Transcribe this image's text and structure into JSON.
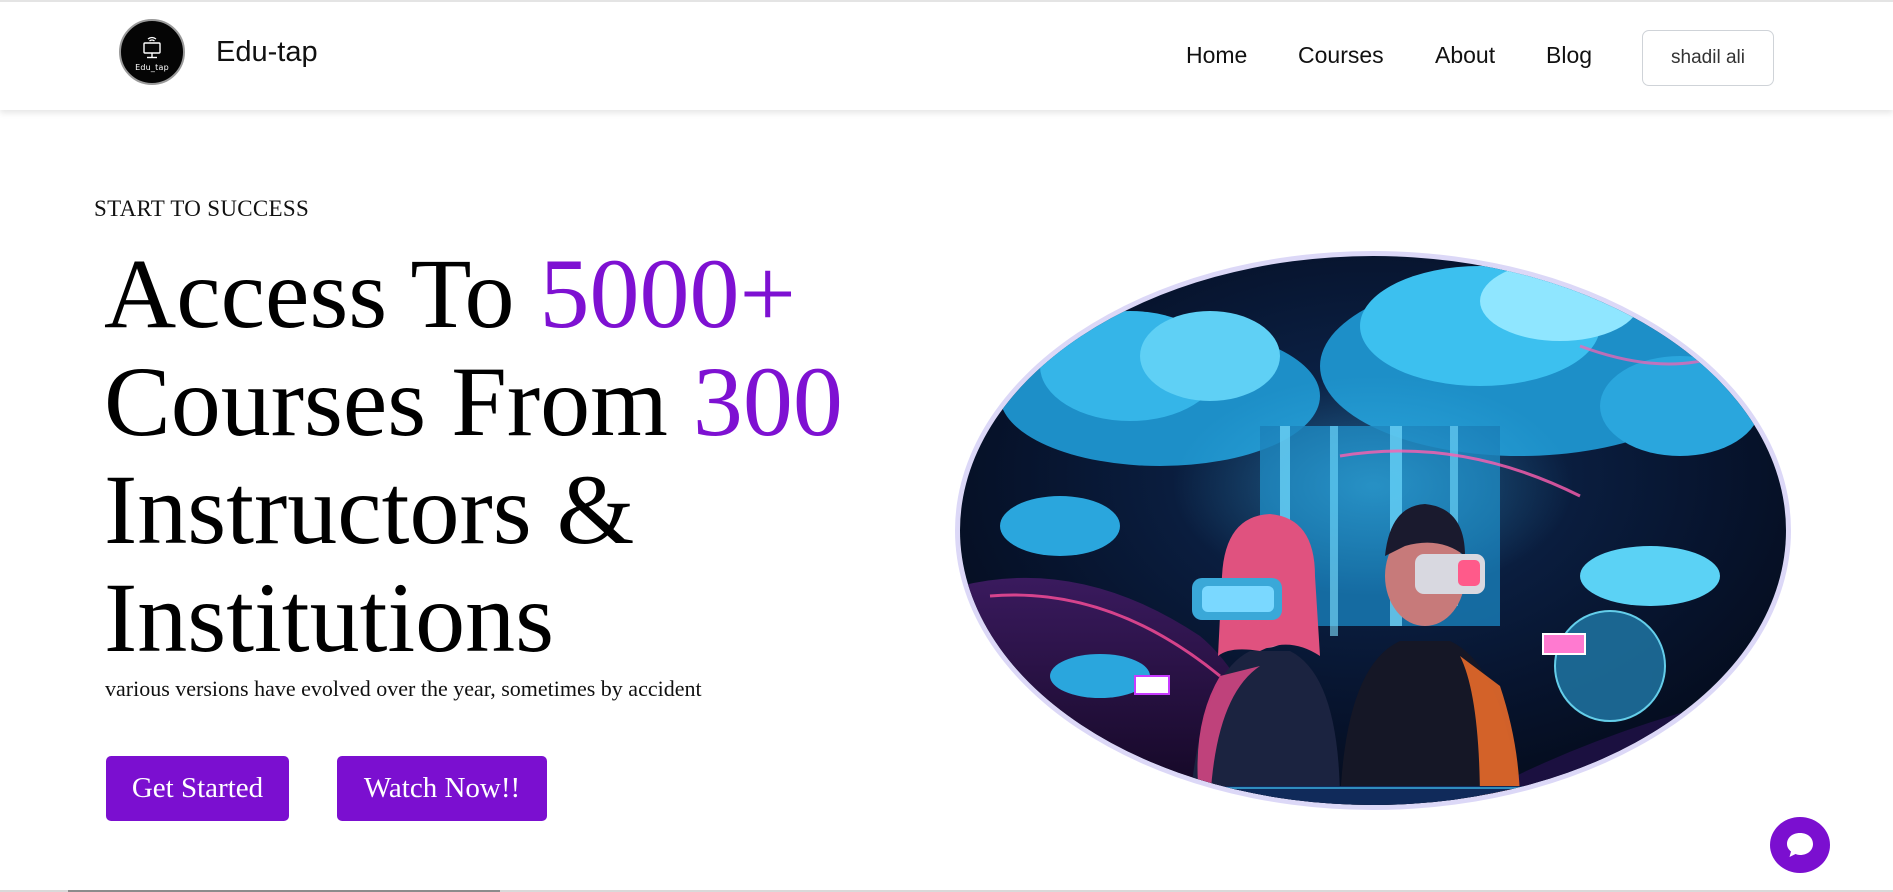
{
  "nav": {
    "logo_icon": "monitor-wifi-icon",
    "logo_text": "Edu_tap",
    "brand": "Edu-tap",
    "links": [
      {
        "label": "Home"
      },
      {
        "label": "Courses"
      },
      {
        "label": "About"
      },
      {
        "label": "Blog"
      }
    ],
    "user_button": "shadil ali"
  },
  "hero": {
    "eyebrow": "START TO SUCCESS",
    "headline": {
      "part1": "Access To ",
      "highlight1": "5000+",
      "part2": "Courses From ",
      "highlight2": "300",
      "part3": "Instructors &",
      "part4": "Institutions"
    },
    "subtext": "various versions have evolved over the year, sometimes by accident",
    "primary_button": "Get Started",
    "secondary_button": "Watch Now!!",
    "image_icon": "vr-couple-illustration"
  },
  "chat": {
    "icon": "chat-bubble-icon"
  },
  "colors": {
    "accent": "#7b0fd0",
    "highlight_text": "#7e11d2",
    "image_border": "#dcd8f7"
  }
}
